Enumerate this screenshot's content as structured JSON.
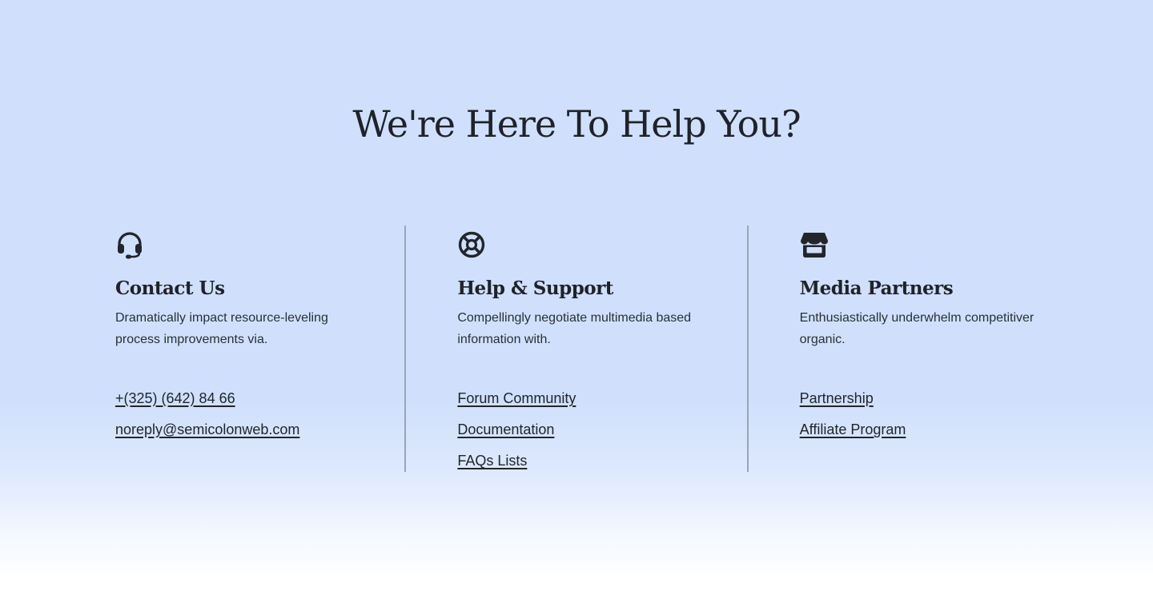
{
  "heading": "We're Here To Help You?",
  "columns": [
    {
      "icon": "headset-icon",
      "title": "Contact Us",
      "description": "Dramatically impact resource-leveling process improvements via.",
      "links": [
        "+(325) (642) 84 66",
        "noreply@semicolonweb.com"
      ]
    },
    {
      "icon": "lifebuoy-icon",
      "title": "Help & Support",
      "description": "Compellingly negotiate multimedia based information with.",
      "links": [
        "Forum Community",
        "Documentation",
        "FAQs Lists"
      ]
    },
    {
      "icon": "storefront-icon",
      "title": "Media Partners",
      "description": "Enthusiastically underwhelm competitiver organic.",
      "links": [
        "Partnership",
        "Affiliate Program"
      ]
    }
  ],
  "colors": {
    "background": "#d0e0fc",
    "text": "#22252b",
    "divider": "#9aa4b3"
  }
}
